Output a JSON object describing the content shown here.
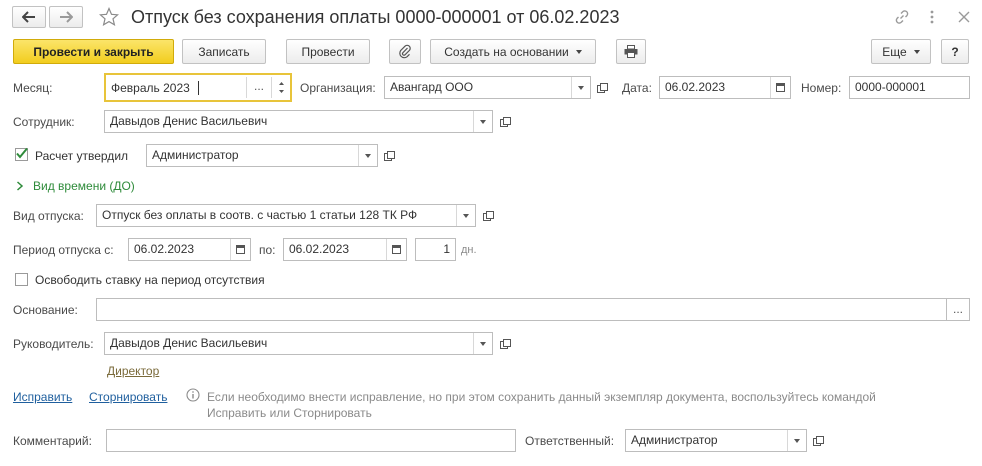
{
  "window": {
    "title": "Отпуск без сохранения оплаты 0000-000001 от 06.02.2023"
  },
  "toolbar": {
    "post_and_close": "Провести и закрыть",
    "save": "Записать",
    "post": "Провести",
    "create_based_on": "Создать на основании",
    "more": "Еще",
    "help": "?"
  },
  "form": {
    "month_label": "Месяц:",
    "month_value": "Февраль 2023",
    "month_picker": "...",
    "organization_label": "Организация:",
    "organization_value": "Авангард ООО",
    "date_label": "Дата:",
    "date_value": "06.02.2023",
    "number_label": "Номер:",
    "number_value": "0000-000001",
    "employee_label": "Сотрудник:",
    "employee_value": "Давыдов Денис Васильевич",
    "approved_label": "Расчет утвердил",
    "approved_checked": true,
    "approved_value": "Администратор",
    "time_type_label": "Вид времени (ДО)",
    "leave_type_label": "Вид отпуска:",
    "leave_type_value": "Отпуск без оплаты в соотв. с частью 1 статьи 128 ТК РФ",
    "period_from_label": "Период отпуска с:",
    "period_from_value": "06.02.2023",
    "period_to_label": "по:",
    "period_to_value": "06.02.2023",
    "days_value": "1",
    "days_unit": "дн.",
    "release_rate_label": "Освободить ставку на период отсутствия",
    "release_rate_checked": false,
    "basis_label": "Основание:",
    "basis_value": "",
    "basis_picker": "...",
    "manager_label": "Руководитель:",
    "manager_value": "Давыдов Денис Васильевич",
    "manager_position": "Директор",
    "fix_link": "Исправить",
    "reverse_link": "Сторнировать",
    "info_text_line1": "Если необходимо внести исправление, но при этом сохранить данный экземпляр документа, воспользуйтесь командой",
    "info_text_line2": "Исправить или Сторнировать",
    "comment_label": "Комментарий:",
    "comment_value": "",
    "responsible_label": "Ответственный:",
    "responsible_value": "Администратор"
  },
  "icons": {
    "back": "arrow-left-icon",
    "forward": "arrow-right-icon",
    "favorite": "star-icon",
    "link": "link-icon",
    "menu": "kebab-menu-icon",
    "close": "close-icon",
    "attach": "paperclip-icon",
    "print": "printer-icon",
    "info": "info-icon"
  },
  "colors": {
    "primary_button": "#f2cd1e",
    "link": "#1f5f9e",
    "green_section": "#2e8b3a",
    "focus_border": "#e8c43a"
  }
}
